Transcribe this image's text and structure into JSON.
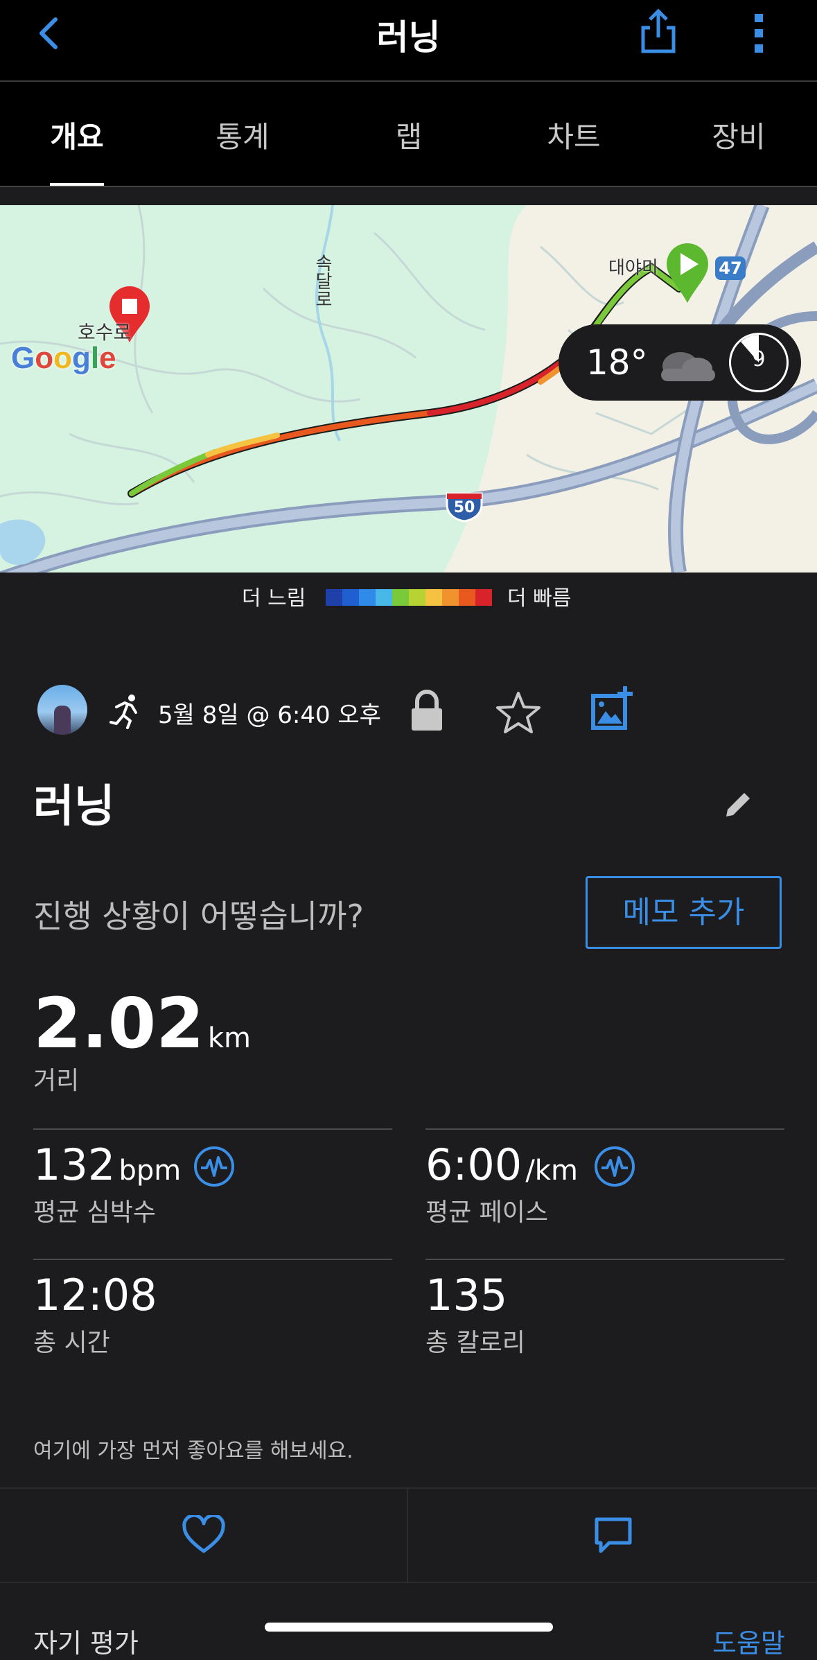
{
  "header": {
    "title": "러닝"
  },
  "tabs": [
    "개요",
    "통계",
    "랩",
    "차트",
    "장비"
  ],
  "map": {
    "road_labels": [
      "속달로",
      "대야미",
      "호수로"
    ],
    "markers": {
      "m": "M",
      "route_47": "47",
      "route_50": "50"
    },
    "provider": "Google",
    "weather": {
      "temp": "18°",
      "wind": "9"
    }
  },
  "legend": {
    "slow": "더 느림",
    "fast": "더 빠름",
    "colors": [
      "#1e40a8",
      "#1f5fd0",
      "#2f8ae8",
      "#47b8e8",
      "#7ac93a",
      "#b7d333",
      "#f5c242",
      "#f0922e",
      "#e8591f",
      "#d8232a"
    ]
  },
  "activity": {
    "date": "5월 8일 @ 6:40 오후",
    "name": "러닝",
    "prompt": "진행 상황이 어떻습니까?",
    "memo_label": "메모 추가",
    "distance": {
      "value": "2.02",
      "unit": "km",
      "label": "거리"
    },
    "heart_rate": {
      "value": "132",
      "unit": "bpm",
      "label": "평균 심박수"
    },
    "pace": {
      "value": "6:00",
      "unit": "/km",
      "label": "평균 페이스"
    },
    "time": {
      "value": "12:08",
      "label": "총 시간"
    },
    "calories": {
      "value": "135",
      "label": "총 칼로리"
    },
    "like_prompt": "여기에 가장 먼저 좋아요를 해보세요."
  },
  "footer": {
    "self_eval": "자기 평가",
    "help": "도움말"
  },
  "colors": {
    "accent": "#3a8ee6",
    "start": "#5cb82e",
    "end": "#e52d2d"
  }
}
